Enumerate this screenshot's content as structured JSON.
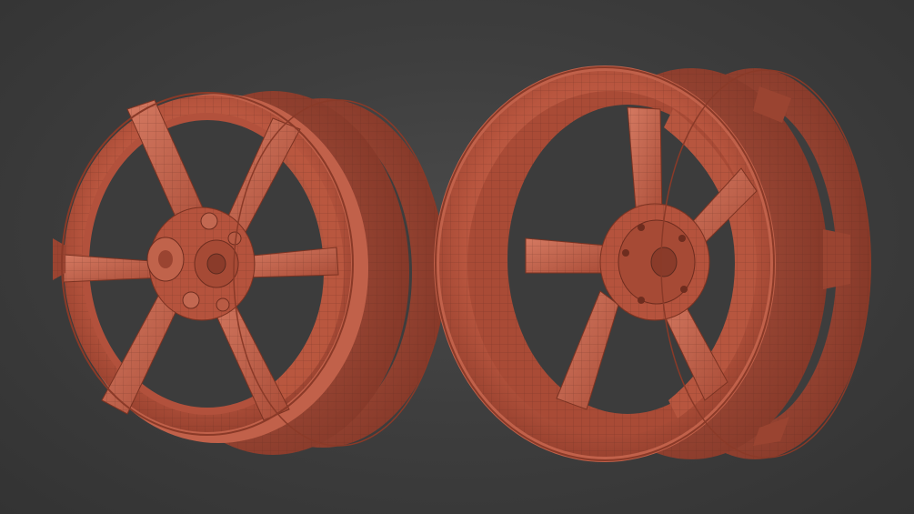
{
  "scene": {
    "background_color": "#3b3b3b",
    "model_color": "#c2604a",
    "wire_color": "#5a2a1f",
    "objects": [
      {
        "name": "six-spoke-wheel",
        "spokes": 6
      },
      {
        "name": "five-spoke-wheel",
        "spokes": 5
      }
    ]
  }
}
